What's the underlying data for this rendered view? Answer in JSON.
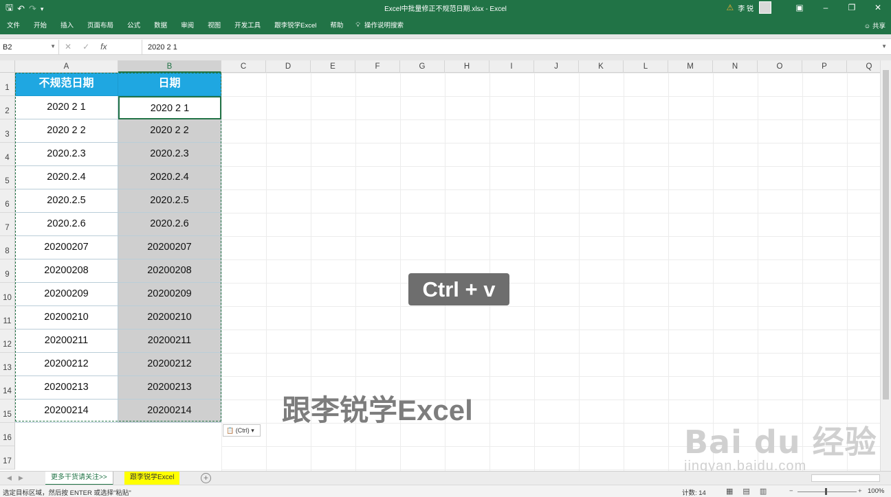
{
  "titlebar": {
    "title": "Excel中批量修正不规范日期.xlsx  -  Excel",
    "user": "李 锐"
  },
  "ribbon": {
    "tabs": [
      "文件",
      "开始",
      "插入",
      "页面布局",
      "公式",
      "数据",
      "审阅",
      "视图",
      "开发工具",
      "跟李锐学Excel",
      "帮助"
    ],
    "tell_me": "操作说明搜索",
    "share": "共享"
  },
  "formula_bar": {
    "name_box": "B2",
    "fx": "fx",
    "content": "2020 2 1"
  },
  "columns": [
    "A",
    "B",
    "C",
    "D",
    "E",
    "F",
    "G",
    "H",
    "I",
    "J",
    "K",
    "L",
    "M",
    "N",
    "O",
    "P",
    "Q"
  ],
  "rows": [
    "1",
    "2",
    "3",
    "4",
    "5",
    "6",
    "7",
    "8",
    "9",
    "10",
    "11",
    "12",
    "13",
    "14",
    "15",
    "16",
    "17"
  ],
  "table": {
    "headers": [
      "不规范日期",
      "日期"
    ],
    "col_a": [
      "2020 2 1",
      "2020 2 2",
      "2020.2.3",
      "2020.2.4",
      "2020.2.5",
      "2020.2.6",
      "20200207",
      "20200208",
      "20200209",
      "20200210",
      "20200211",
      "20200212",
      "20200213",
      "20200214"
    ],
    "col_b": [
      "2020 2 1",
      "2020 2 2",
      "2020.2.3",
      "2020.2.4",
      "2020.2.5",
      "2020.2.6",
      "20200207",
      "20200208",
      "20200209",
      "20200210",
      "20200211",
      "20200212",
      "20200213",
      "20200214"
    ]
  },
  "paste_options": "(Ctrl)",
  "overlay": {
    "shortcut": "Ctrl + v",
    "brand": "跟李锐学Excel",
    "watermark_logo": "Bai du 经验",
    "watermark_url": "jingyan.baidu.com"
  },
  "sheets": [
    "更多干货请关注>>",
    "跟李锐学Excel"
  ],
  "status": {
    "message": "选定目标区域，然后按 ENTER 或选择\"粘贴\"",
    "count": "计数: 14",
    "zoom": "100%"
  },
  "colors": {
    "excel_green": "#217346",
    "header_fill": "#1fa7e1",
    "sheet_tab_highlight": "#ffff00"
  }
}
